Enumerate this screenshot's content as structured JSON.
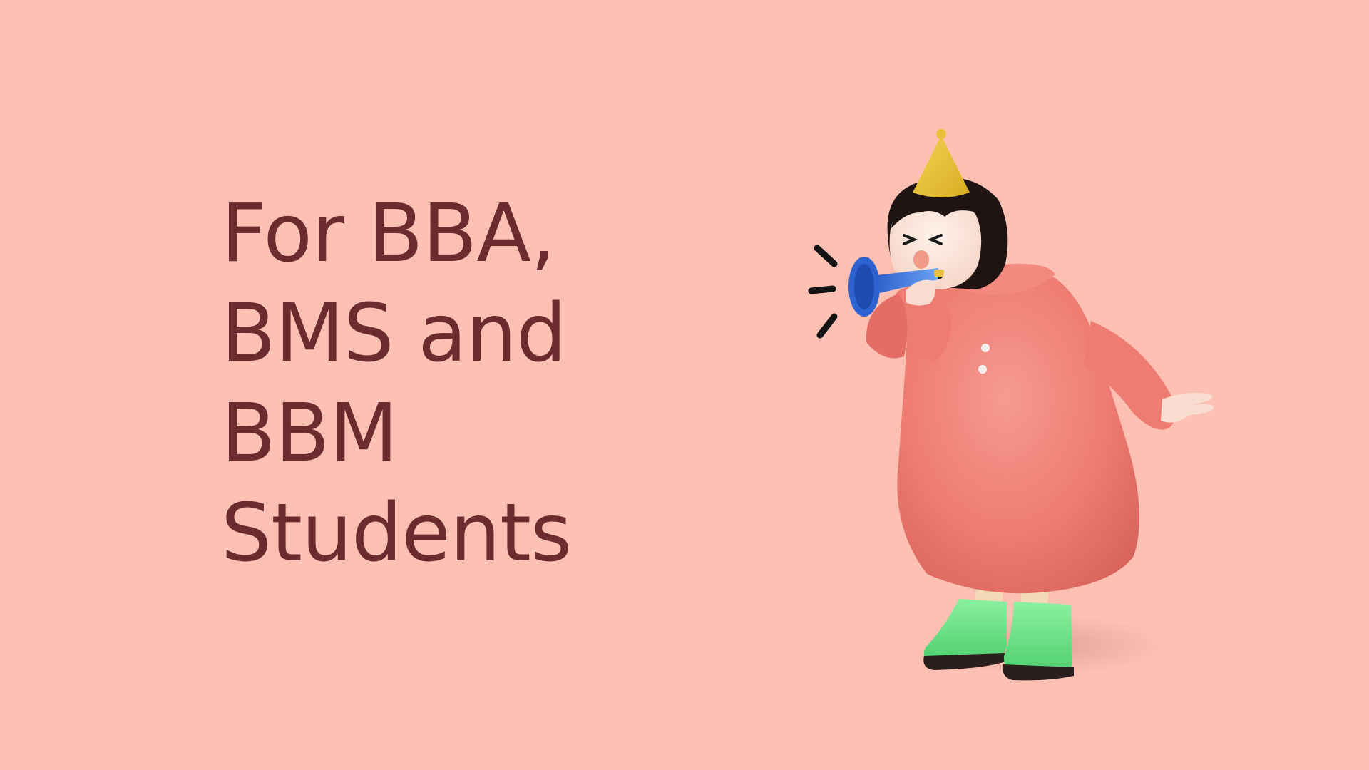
{
  "headline": {
    "lines": [
      "For BBA,",
      "BMS and",
      "BBM",
      "Students"
    ]
  },
  "colors": {
    "background": "#ffc0b4",
    "headline_text": "#6b2c2f",
    "coat": "#f17c74",
    "hat": "#e8c23a",
    "horn": "#2f6fd6",
    "boots": "#6fe08a",
    "hair": "#1f1412"
  },
  "illustration": {
    "subject": "girl-blowing-party-horn",
    "icons": [
      "party-hat-icon",
      "party-horn-icon",
      "sound-lines-icon"
    ]
  }
}
